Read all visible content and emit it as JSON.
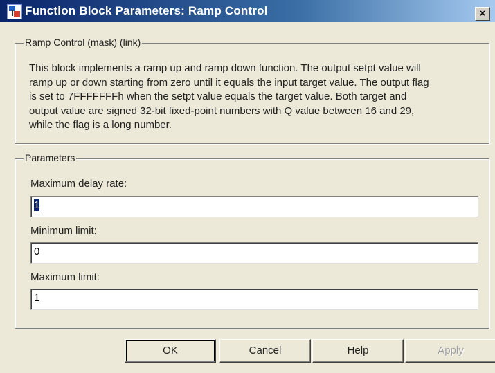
{
  "window": {
    "title": "Function Block Parameters: Ramp Control",
    "close_glyph": "×"
  },
  "mask": {
    "legend": "Ramp Control (mask) (link)",
    "description_lines": [
      "This block implements a ramp up and ramp down function. The output setpt value will",
      "ramp up or down starting from zero until it equals the input target value. The output flag",
      "is set to 7FFFFFFFh when the setpt value equals the target value. Both target and",
      "output value are signed 32-bit fixed-point numbers with Q value between 16 and 29,",
      "while the flag is a long number."
    ]
  },
  "parameters": {
    "legend": "Parameters",
    "max_delay_rate": {
      "label": "Maximum delay rate:",
      "value": "1"
    },
    "min_limit": {
      "label": "Minimum limit:",
      "value": "0"
    },
    "max_limit": {
      "label": "Maximum limit:",
      "value": "1"
    }
  },
  "buttons": {
    "ok": "OK",
    "cancel": "Cancel",
    "help": "Help",
    "apply": "Apply"
  }
}
